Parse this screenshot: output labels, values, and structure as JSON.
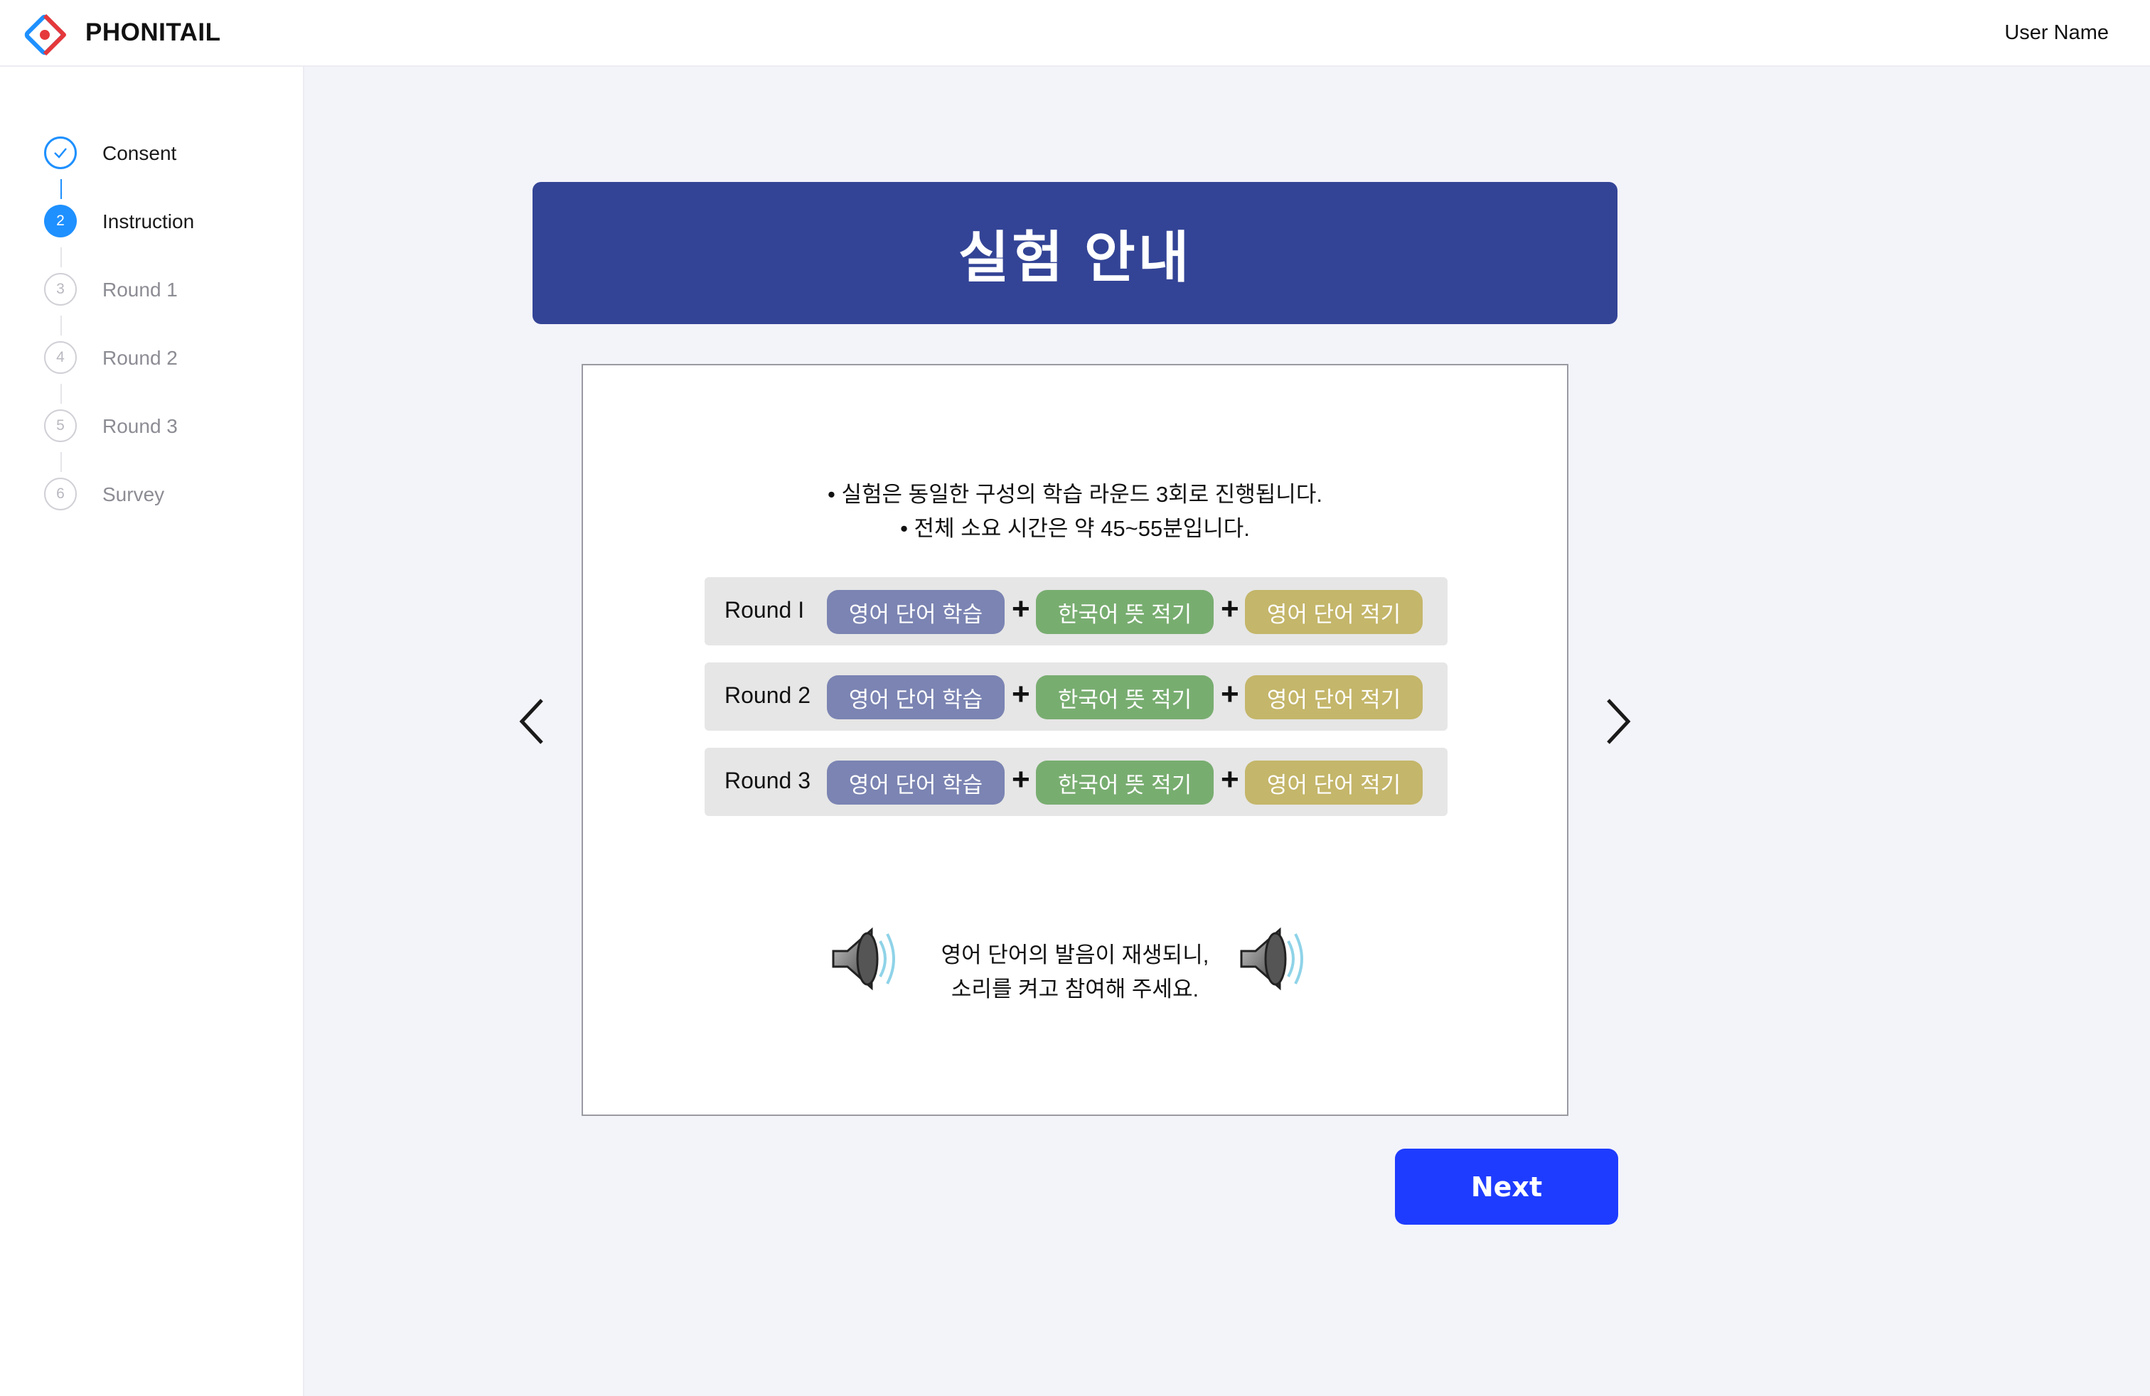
{
  "header": {
    "brand": "PHONITAIL",
    "user_name": "User Name",
    "logo_colors": {
      "primary": "#1e90ff",
      "accent": "#e5383b"
    }
  },
  "sidebar": {
    "steps": [
      {
        "number": "1",
        "label": "Consent",
        "state": "done"
      },
      {
        "number": "2",
        "label": "Instruction",
        "state": "active"
      },
      {
        "number": "3",
        "label": "Round 1",
        "state": "pending"
      },
      {
        "number": "4",
        "label": "Round 2",
        "state": "pending"
      },
      {
        "number": "5",
        "label": "Round 3",
        "state": "pending"
      },
      {
        "number": "6",
        "label": "Survey",
        "state": "pending"
      }
    ]
  },
  "main": {
    "title": "실험 안내",
    "bullets": [
      "• 실험은 동일한 구성의 학습 라운드 3회로 진행됩니다.",
      "• 전체 소요 시간은 약 45~55분입니다."
    ],
    "rounds": [
      {
        "label": "Round I",
        "steps": [
          "영어 단어 학습",
          "한국어 뜻 적기",
          "영어 단어 적기"
        ]
      },
      {
        "label": "Round 2",
        "steps": [
          "영어 단어 학습",
          "한국어 뜻 적기",
          "영어 단어 적기"
        ]
      },
      {
        "label": "Round 3",
        "steps": [
          "영어 단어 학습",
          "한국어 뜻 적기",
          "영어 단어 적기"
        ]
      }
    ],
    "plus_symbol": "+",
    "sound_notice": [
      "영어 단어의 발음이 재생되니,",
      "소리를 켜고 참여해 주세요."
    ],
    "icons": {
      "prev": "chevron-left-icon",
      "next": "chevron-right-icon",
      "speaker": "speaker-icon"
    }
  },
  "actions": {
    "next_label": "Next"
  },
  "colors": {
    "title_banner": "#334496",
    "pill_learn": "#7b84b2",
    "pill_korean": "#78ad70",
    "pill_english": "#c4b66a",
    "next_button": "#1e3cff",
    "step_active": "#1e90ff"
  }
}
